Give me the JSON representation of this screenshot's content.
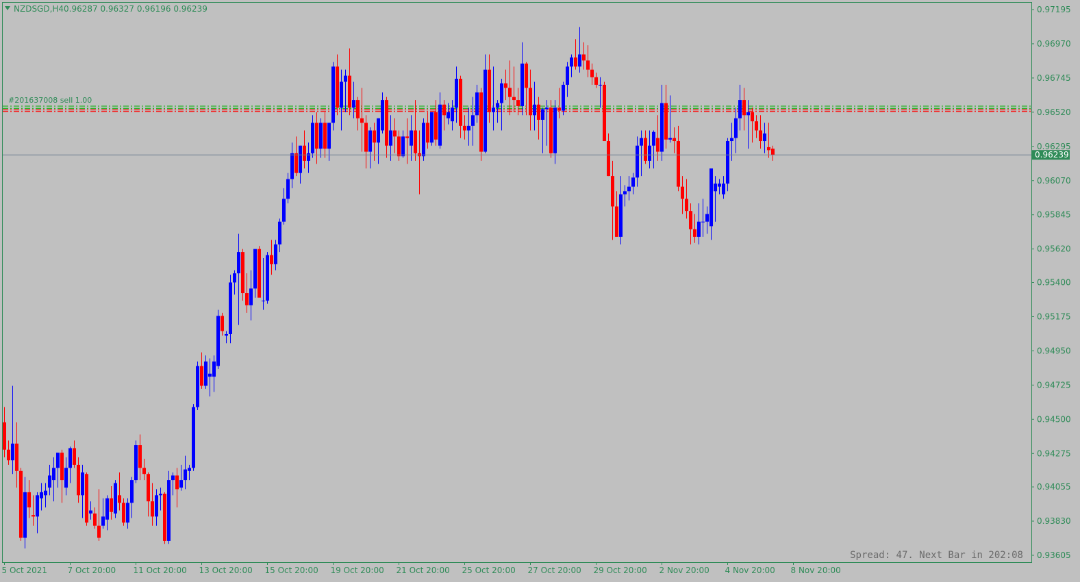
{
  "header": {
    "symbol": "NZDSGD,H4",
    "ohlc": "0.96287 0.96327 0.96196 0.96239"
  },
  "status_text": "Spread: 47. Next Bar in 202:08",
  "trade_label": "#201637008 sell 1.00",
  "colors": {
    "background": "#c0c0c0",
    "axis": "#2e8b57",
    "bull": "#0000ff",
    "bear": "#ff0000",
    "buy_line": "#28b428",
    "sell_line": "#ff0000",
    "bid_line": "#708090",
    "price_tag_bg": "#2e8b57"
  },
  "chart_data": {
    "type": "candlestick",
    "current_price": 0.96239,
    "current_price_label": "0.96239",
    "ylim": [
      0.9356,
      0.9724
    ],
    "y_ticks": [
      "0.97195",
      "0.96970",
      "0.96745",
      "0.96520",
      "0.96295",
      "0.96070",
      "0.95845",
      "0.95620",
      "0.95400",
      "0.95175",
      "0.94950",
      "0.94725",
      "0.94500",
      "0.94275",
      "0.94055",
      "0.93830",
      "0.93605"
    ],
    "x_ticks": [
      "5 Oct 2021",
      "7 Oct 20:00",
      "11 Oct 20:00",
      "13 Oct 20:00",
      "15 Oct 20:00",
      "19 Oct 20:00",
      "21 Oct 20:00",
      "25 Oct 20:00",
      "27 Oct 20:00",
      "29 Oct 20:00",
      "2 Nov 20:00",
      "4 Nov 20:00",
      "8 Nov 20:00"
    ],
    "x_tick_index": [
      0,
      16,
      32,
      48,
      64,
      80,
      96,
      112,
      128,
      144,
      160,
      176,
      192
    ],
    "order_lines": [
      {
        "side": "buy",
        "price": 0.9656
      },
      {
        "side": "buy",
        "price": 0.96545
      },
      {
        "side": "sell",
        "price": 0.96535
      },
      {
        "side": "sell",
        "price": 0.96525
      }
    ],
    "ohlc": [
      [
        0.9448,
        0.9458,
        0.9425,
        0.943
      ],
      [
        0.943,
        0.9436,
        0.942,
        0.9423
      ],
      [
        0.9423,
        0.9472,
        0.9414,
        0.9434
      ],
      [
        0.9434,
        0.9448,
        0.9405,
        0.9416
      ],
      [
        0.9416,
        0.9418,
        0.937,
        0.9372
      ],
      [
        0.9372,
        0.9412,
        0.9365,
        0.9402
      ],
      [
        0.9402,
        0.941,
        0.9385,
        0.9392
      ],
      [
        0.9387,
        0.94,
        0.938,
        0.9386
      ],
      [
        0.9386,
        0.9402,
        0.9375,
        0.94
      ],
      [
        0.9398,
        0.9408,
        0.939,
        0.9402
      ],
      [
        0.94,
        0.9408,
        0.9392,
        0.9403
      ],
      [
        0.9405,
        0.942,
        0.94,
        0.9413
      ],
      [
        0.941,
        0.9425,
        0.9396,
        0.9418
      ],
      [
        0.9418,
        0.9428,
        0.9405,
        0.9428
      ],
      [
        0.9428,
        0.943,
        0.9395,
        0.941
      ],
      [
        0.9405,
        0.9425,
        0.94,
        0.9418
      ],
      [
        0.9418,
        0.9432,
        0.9408,
        0.9431
      ],
      [
        0.9431,
        0.9436,
        0.9418,
        0.942
      ],
      [
        0.942,
        0.9425,
        0.9395,
        0.94
      ],
      [
        0.94,
        0.942,
        0.9385,
        0.9415
      ],
      [
        0.9414,
        0.9415,
        0.938,
        0.9382
      ],
      [
        0.9388,
        0.9396,
        0.9384,
        0.939
      ],
      [
        0.9388,
        0.9392,
        0.9378,
        0.938
      ],
      [
        0.938,
        0.9404,
        0.937,
        0.9372
      ],
      [
        0.938,
        0.9398,
        0.9378,
        0.9386
      ],
      [
        0.9384,
        0.94,
        0.9377,
        0.9398
      ],
      [
        0.9398,
        0.9406,
        0.9384,
        0.9389
      ],
      [
        0.9388,
        0.941,
        0.9385,
        0.9408
      ],
      [
        0.94,
        0.9415,
        0.939,
        0.9395
      ],
      [
        0.9395,
        0.9398,
        0.938,
        0.9382
      ],
      [
        0.9382,
        0.9398,
        0.9378,
        0.9395
      ],
      [
        0.9395,
        0.9412,
        0.9385,
        0.941
      ],
      [
        0.941,
        0.9436,
        0.9408,
        0.9433
      ],
      [
        0.9433,
        0.944,
        0.941,
        0.9418
      ],
      [
        0.9418,
        0.9424,
        0.941,
        0.9414
      ],
      [
        0.9414,
        0.9415,
        0.9386,
        0.9396
      ],
      [
        0.9396,
        0.9408,
        0.938,
        0.9386
      ],
      [
        0.9386,
        0.9404,
        0.938,
        0.94
      ],
      [
        0.94,
        0.9405,
        0.939,
        0.9401
      ],
      [
        0.9401,
        0.9402,
        0.9368,
        0.937
      ],
      [
        0.937,
        0.9416,
        0.9368,
        0.941
      ],
      [
        0.941,
        0.9415,
        0.94,
        0.9413
      ],
      [
        0.9413,
        0.9418,
        0.9392,
        0.9404
      ],
      [
        0.9405,
        0.942,
        0.9403,
        0.941
      ],
      [
        0.941,
        0.9426,
        0.9404,
        0.9417
      ],
      [
        0.9416,
        0.942,
        0.941,
        0.9418
      ],
      [
        0.9418,
        0.946,
        0.9416,
        0.9458
      ],
      [
        0.9458,
        0.9488,
        0.9456,
        0.9485
      ],
      [
        0.9485,
        0.9494,
        0.947,
        0.9472
      ],
      [
        0.9472,
        0.9492,
        0.947,
        0.9488
      ],
      [
        0.9478,
        0.949,
        0.9465,
        0.948
      ],
      [
        0.9478,
        0.9492,
        0.9468,
        0.9488
      ],
      [
        0.9485,
        0.9522,
        0.9483,
        0.9518
      ],
      [
        0.9518,
        0.952,
        0.9505,
        0.9508
      ],
      [
        0.9505,
        0.9508,
        0.95,
        0.9506
      ],
      [
        0.9506,
        0.9545,
        0.95,
        0.954
      ],
      [
        0.954,
        0.9548,
        0.9532,
        0.9546
      ],
      [
        0.9546,
        0.9572,
        0.9512,
        0.956
      ],
      [
        0.956,
        0.9562,
        0.9528,
        0.9533
      ],
      [
        0.9533,
        0.9546,
        0.952,
        0.9525
      ],
      [
        0.9525,
        0.9548,
        0.9515,
        0.9536
      ],
      [
        0.9536,
        0.956,
        0.953,
        0.9562
      ],
      [
        0.9562,
        0.9564,
        0.9535,
        0.953
      ],
      [
        0.9528,
        0.9556,
        0.9522,
        0.9528
      ],
      [
        0.9528,
        0.956,
        0.9526,
        0.9558
      ],
      [
        0.9558,
        0.9568,
        0.9545,
        0.9552
      ],
      [
        0.9552,
        0.9568,
        0.9548,
        0.9565
      ],
      [
        0.9565,
        0.9582,
        0.956,
        0.958
      ],
      [
        0.958,
        0.9602,
        0.9578,
        0.9595
      ],
      [
        0.9595,
        0.9612,
        0.9592,
        0.9608
      ],
      [
        0.9608,
        0.9632,
        0.9602,
        0.9625
      ],
      [
        0.9625,
        0.9636,
        0.961,
        0.9612
      ],
      [
        0.9612,
        0.963,
        0.9605,
        0.963
      ],
      [
        0.963,
        0.964,
        0.9615,
        0.962
      ],
      [
        0.962,
        0.9632,
        0.9612,
        0.9625
      ],
      [
        0.9625,
        0.965,
        0.9622,
        0.9645
      ],
      [
        0.9645,
        0.9652,
        0.9618,
        0.9628
      ],
      [
        0.9628,
        0.9648,
        0.9622,
        0.9645
      ],
      [
        0.9645,
        0.9652,
        0.9622,
        0.9628
      ],
      [
        0.9628,
        0.9645,
        0.962,
        0.9645
      ],
      [
        0.9645,
        0.9685,
        0.964,
        0.9682
      ],
      [
        0.9682,
        0.969,
        0.965,
        0.9655
      ],
      [
        0.9655,
        0.968,
        0.964,
        0.9672
      ],
      [
        0.9672,
        0.968,
        0.9652,
        0.9676
      ],
      [
        0.9676,
        0.9694,
        0.965,
        0.9655
      ],
      [
        0.9655,
        0.9672,
        0.9648,
        0.966
      ],
      [
        0.966,
        0.9662,
        0.964,
        0.9648
      ],
      [
        0.9648,
        0.9668,
        0.9626,
        0.9645
      ],
      [
        0.9645,
        0.965,
        0.9615,
        0.9626
      ],
      [
        0.9626,
        0.9642,
        0.9615,
        0.964
      ],
      [
        0.964,
        0.9645,
        0.962,
        0.9632
      ],
      [
        0.9632,
        0.9648,
        0.9618,
        0.9648
      ],
      [
        0.964,
        0.9665,
        0.9638,
        0.966
      ],
      [
        0.966,
        0.9662,
        0.9622,
        0.963
      ],
      [
        0.963,
        0.965,
        0.962,
        0.964
      ],
      [
        0.964,
        0.9648,
        0.9625,
        0.9636
      ],
      [
        0.9636,
        0.964,
        0.962,
        0.9623
      ],
      [
        0.9623,
        0.964,
        0.9622,
        0.9636
      ],
      [
        0.9636,
        0.9648,
        0.9618,
        0.9635
      ],
      [
        0.963,
        0.965,
        0.962,
        0.964
      ],
      [
        0.964,
        0.966,
        0.962,
        0.9625
      ],
      [
        0.9625,
        0.964,
        0.9598,
        0.9623
      ],
      [
        0.9623,
        0.9648,
        0.962,
        0.9645
      ],
      [
        0.9645,
        0.9652,
        0.9628,
        0.9632
      ],
      [
        0.9632,
        0.965,
        0.963,
        0.9652
      ],
      [
        0.9652,
        0.966,
        0.963,
        0.9634
      ],
      [
        0.963,
        0.9665,
        0.9628,
        0.9657
      ],
      [
        0.9657,
        0.966,
        0.964,
        0.965
      ],
      [
        0.9648,
        0.9658,
        0.9644,
        0.9652
      ],
      [
        0.9646,
        0.966,
        0.964,
        0.9655
      ],
      [
        0.9655,
        0.9682,
        0.9645,
        0.9674
      ],
      [
        0.9674,
        0.9676,
        0.9635,
        0.9643
      ],
      [
        0.9643,
        0.965,
        0.9634,
        0.964
      ],
      [
        0.964,
        0.9655,
        0.963,
        0.9643
      ],
      [
        0.9643,
        0.9662,
        0.963,
        0.965
      ],
      [
        0.965,
        0.967,
        0.9645,
        0.9665
      ],
      [
        0.9665,
        0.9668,
        0.962,
        0.9626
      ],
      [
        0.9626,
        0.969,
        0.9625,
        0.968
      ],
      [
        0.968,
        0.969,
        0.9645,
        0.9652
      ],
      [
        0.9652,
        0.9682,
        0.964,
        0.9655
      ],
      [
        0.9655,
        0.966,
        0.9645,
        0.9658
      ],
      [
        0.9658,
        0.9674,
        0.964,
        0.9671
      ],
      [
        0.9671,
        0.968,
        0.966,
        0.9668
      ],
      [
        0.9668,
        0.9686,
        0.965,
        0.9662
      ],
      [
        0.9662,
        0.9682,
        0.9652,
        0.966
      ],
      [
        0.966,
        0.9668,
        0.965,
        0.9656
      ],
      [
        0.9656,
        0.9698,
        0.965,
        0.9684
      ],
      [
        0.9684,
        0.9685,
        0.965,
        0.9668
      ],
      [
        0.9668,
        0.968,
        0.964,
        0.965
      ],
      [
        0.965,
        0.9672,
        0.964,
        0.9657
      ],
      [
        0.9657,
        0.9662,
        0.9634,
        0.9647
      ],
      [
        0.9647,
        0.9655,
        0.9625,
        0.9654
      ],
      [
        0.9654,
        0.966,
        0.963,
        0.9655
      ],
      [
        0.9655,
        0.966,
        0.9622,
        0.9625
      ],
      [
        0.9625,
        0.966,
        0.9618,
        0.9655
      ],
      [
        0.9655,
        0.9668,
        0.9648,
        0.9653
      ],
      [
        0.9653,
        0.9672,
        0.965,
        0.967
      ],
      [
        0.967,
        0.9685,
        0.9662,
        0.9682
      ],
      [
        0.9682,
        0.969,
        0.9675,
        0.9688
      ],
      [
        0.9688,
        0.97,
        0.968,
        0.9682
      ],
      [
        0.9682,
        0.9708,
        0.9678,
        0.969
      ],
      [
        0.969,
        0.9698,
        0.968,
        0.9686
      ],
      [
        0.9686,
        0.9696,
        0.9675,
        0.968
      ],
      [
        0.968,
        0.9684,
        0.967,
        0.9675
      ],
      [
        0.9675,
        0.9678,
        0.9668,
        0.967
      ],
      [
        0.967,
        0.9675,
        0.9655,
        0.967
      ],
      [
        0.967,
        0.9672,
        0.9638,
        0.9633
      ],
      [
        0.9633,
        0.9638,
        0.961,
        0.961
      ],
      [
        0.961,
        0.962,
        0.9568,
        0.959
      ],
      [
        0.959,
        0.96,
        0.957,
        0.957
      ],
      [
        0.957,
        0.961,
        0.9565,
        0.9598
      ],
      [
        0.9598,
        0.9604,
        0.959,
        0.96
      ],
      [
        0.96,
        0.961,
        0.9594,
        0.9603
      ],
      [
        0.9603,
        0.9612,
        0.9598,
        0.9609
      ],
      [
        0.9609,
        0.9636,
        0.9603,
        0.963
      ],
      [
        0.963,
        0.964,
        0.961,
        0.9635
      ],
      [
        0.9635,
        0.964,
        0.9618,
        0.962
      ],
      [
        0.962,
        0.964,
        0.9615,
        0.963
      ],
      [
        0.963,
        0.964,
        0.9615,
        0.9639
      ],
      [
        0.9635,
        0.965,
        0.962,
        0.9626
      ],
      [
        0.9626,
        0.967,
        0.962,
        0.9658
      ],
      [
        0.9658,
        0.967,
        0.9628,
        0.9634
      ],
      [
        0.9634,
        0.9663,
        0.9632,
        0.9635
      ],
      [
        0.9635,
        0.9642,
        0.9625,
        0.9633
      ],
      [
        0.9633,
        0.9643,
        0.96,
        0.9603
      ],
      [
        0.9603,
        0.961,
        0.9585,
        0.9595
      ],
      [
        0.9595,
        0.9608,
        0.9582,
        0.9587
      ],
      [
        0.9587,
        0.9592,
        0.9565,
        0.9575
      ],
      [
        0.9575,
        0.9585,
        0.9566,
        0.957
      ],
      [
        0.957,
        0.9592,
        0.9565,
        0.958
      ],
      [
        0.958,
        0.9595,
        0.957,
        0.958
      ],
      [
        0.958,
        0.959,
        0.9572,
        0.9585
      ],
      [
        0.9577,
        0.96,
        0.9568,
        0.9615
      ],
      [
        0.96,
        0.961,
        0.958,
        0.9605
      ],
      [
        0.9603,
        0.9608,
        0.9598,
        0.9605
      ],
      [
        0.9598,
        0.961,
        0.9595,
        0.9605
      ],
      [
        0.9605,
        0.9635,
        0.96,
        0.9633
      ],
      [
        0.9633,
        0.9645,
        0.962,
        0.9635
      ],
      [
        0.9635,
        0.9655,
        0.9625,
        0.9648
      ],
      [
        0.9648,
        0.967,
        0.964,
        0.966
      ],
      [
        0.966,
        0.9668,
        0.964,
        0.965
      ],
      [
        0.965,
        0.966,
        0.9628,
        0.9652
      ],
      [
        0.9652,
        0.9655,
        0.9632,
        0.9646
      ],
      [
        0.9646,
        0.965,
        0.9635,
        0.964
      ],
      [
        0.964,
        0.965,
        0.9628,
        0.9633
      ],
      [
        0.9633,
        0.9645,
        0.9625,
        0.9638
      ],
      [
        0.9629,
        0.9645,
        0.9622,
        0.9627
      ],
      [
        0.9628,
        0.963,
        0.962,
        0.9624
      ]
    ]
  }
}
